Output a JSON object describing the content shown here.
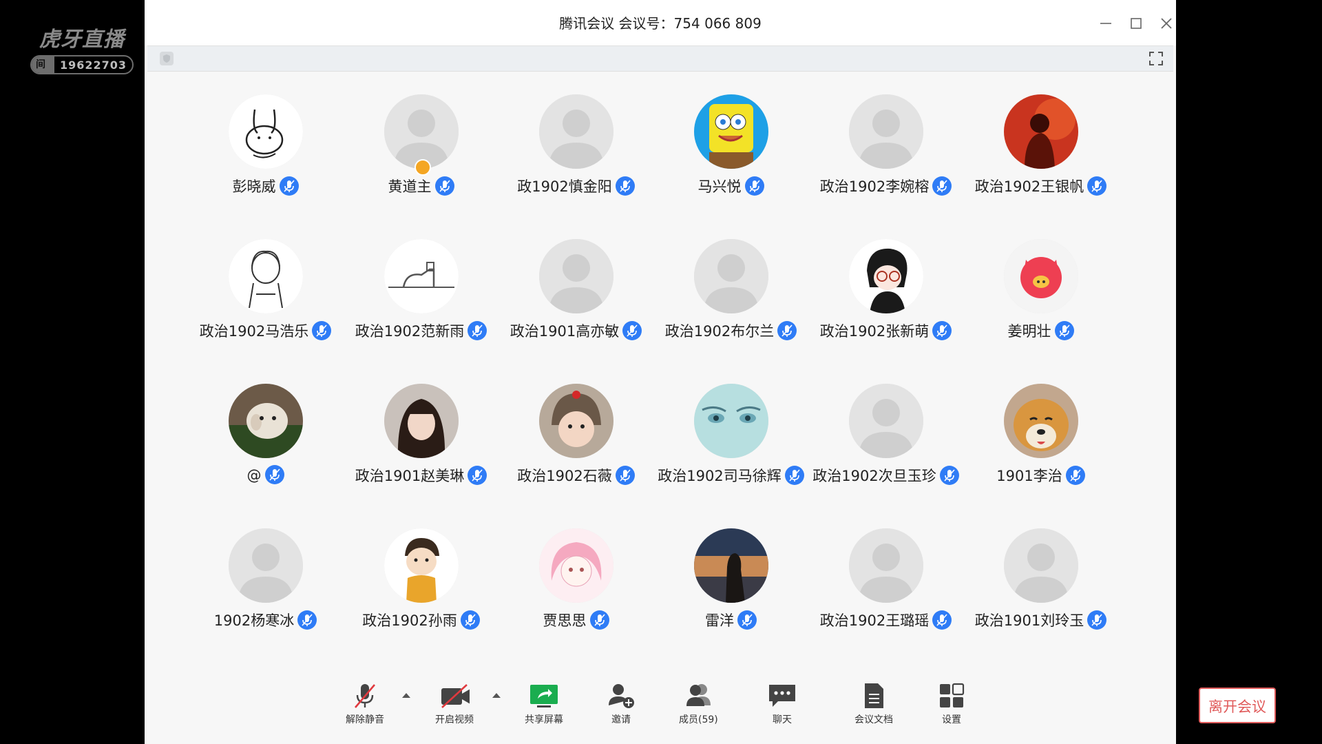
{
  "watermark": {
    "logo": "虎牙直播",
    "room_label": "房间号",
    "room_number": "19622703"
  },
  "window": {
    "title": "腾讯会议 会议号：754 066 809"
  },
  "participants": [
    {
      "name": "彭晓威",
      "avatar": "bunny-sketch"
    },
    {
      "name": "黄道主",
      "avatar": "default",
      "host": true
    },
    {
      "name": "政1902慎金阳",
      "avatar": "default"
    },
    {
      "name": "马兴悦",
      "avatar": "spongebob"
    },
    {
      "name": "政治1902李婉榕",
      "avatar": "default"
    },
    {
      "name": "政治1902王银帆",
      "avatar": "red-photo"
    },
    {
      "name": "政治1902马浩乐",
      "avatar": "girl-sketch"
    },
    {
      "name": "政治1902范新雨",
      "avatar": "figure-sketch"
    },
    {
      "name": "政治1901高亦敏",
      "avatar": "default"
    },
    {
      "name": "政治1902布尔兰",
      "avatar": "default"
    },
    {
      "name": "政治1902张新萌",
      "avatar": "anime-glasses"
    },
    {
      "name": "姜明壮",
      "avatar": "pink-pig"
    },
    {
      "name": "@",
      "avatar": "lamb"
    },
    {
      "name": "政治1901赵美琳",
      "avatar": "girl-photo"
    },
    {
      "name": "政治1902石薇",
      "avatar": "baby-photo"
    },
    {
      "name": "政治1902司马徐辉",
      "avatar": "anime-eyes"
    },
    {
      "name": "政治1902次旦玉珍",
      "avatar": "default"
    },
    {
      "name": "1901李治",
      "avatar": "shiba"
    },
    {
      "name": "1902杨寒冰",
      "avatar": "default"
    },
    {
      "name": "政治1902孙雨",
      "avatar": "cartoon-boy"
    },
    {
      "name": "贾思思",
      "avatar": "pink-anime"
    },
    {
      "name": "雷洋",
      "avatar": "sunset-photo"
    },
    {
      "name": "政治1902王璐瑶",
      "avatar": "default"
    },
    {
      "name": "政治1901刘玲玉",
      "avatar": "default"
    }
  ],
  "toolbar": {
    "unmute": "解除静音",
    "start_video": "开启视频",
    "share_screen": "共享屏幕",
    "invite": "邀请",
    "members": "成员(59)",
    "chat": "聊天",
    "docs": "会议文档",
    "settings": "设置",
    "leave": "离开会议"
  },
  "colors": {
    "mic_blue": "#2f7cf6",
    "leave_red": "#e05a5a",
    "share_green": "#1aad4f"
  }
}
